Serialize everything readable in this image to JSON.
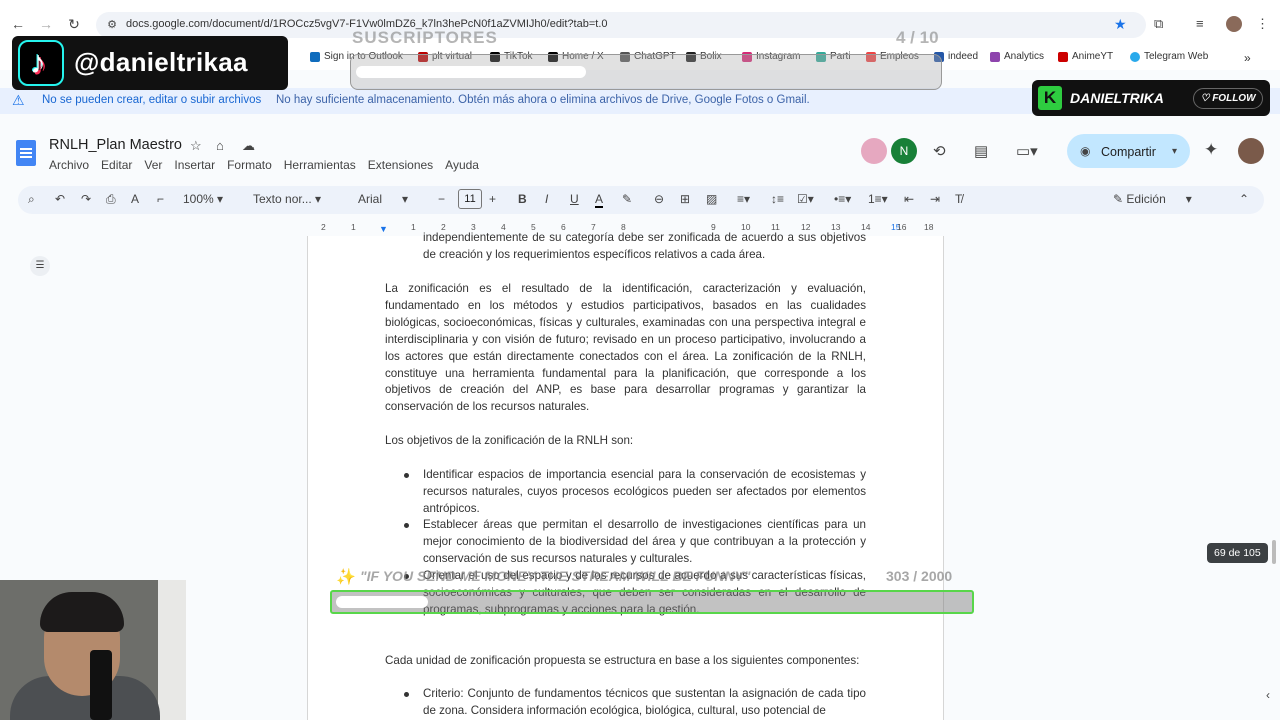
{
  "browser": {
    "url": "docs.google.com/document/d/1ROCcz5vgV7-F1Vw0lmDZ6_k7ln3hePcN0f1aZVMIJh0/edit?tab=t.0"
  },
  "bookmarks": [
    "Sign in to Outlook",
    "plt virtual",
    "TikTok",
    "Home / X",
    "ChatGPT",
    "Bolix",
    "Instagram",
    "Parti",
    "Empleos",
    "indeed",
    "Analytics",
    "AnimeYT",
    "Telegram Web"
  ],
  "warning": {
    "title": "No se pueden crear, editar o subir archivos",
    "message": "No hay suficiente almacenamiento. Obtén más ahora o elimina archivos de Drive, Google Fotos o Gmail."
  },
  "doc": {
    "title": "RNLH_Plan Maestro",
    "menu": [
      "Archivo",
      "Editar",
      "Ver",
      "Insertar",
      "Formato",
      "Herramientas",
      "Extensiones",
      "Ayuda"
    ],
    "avatar_letter": "N",
    "share_label": "Compartir"
  },
  "toolbar": {
    "zoom": "100%",
    "style": "Texto nor...",
    "font": "Arial",
    "font_size": "11",
    "mode": "Edición"
  },
  "ruler": [
    "2",
    "1",
    "1",
    "2",
    "3",
    "4",
    "5",
    "6",
    "7",
    "8",
    "9",
    "10",
    "11",
    "12",
    "13",
    "14",
    "15",
    "16",
    "17",
    "18"
  ],
  "content": {
    "p0": "independientemente de su categoría debe ser zonificada de acuerdo a sus objetivos de creación y los requerimientos específicos relativos a cada área.",
    "p1": "La zonificación es el resultado de la identificación, caracterización y evaluación, fundamentado en los métodos y estudios participativos, basados en las cualidades biológicas, socioeconómicas, físicas y culturales, examinadas con una perspectiva integral e interdisciplinaria y con visión de futuro; revisado en un proceso participativo, involucrando a los actores que están directamente conectados con el área. La zonificación de la RNLH, constituye una herramienta fundamental para la planificación, que corresponde a los objetivos de creación del ANP, es base para desarrollar programas y garantizar la conservación de los recursos naturales.",
    "p2": "Los objetivos de la zonificación de la RNLH son:",
    "b1": "Identificar espacios de importancia esencial para la conservación de ecosistemas y recursos naturales, cuyos procesos ecológicos pueden ser afectados por elementos antrópicos.",
    "b2": "Establecer áreas que permitan el desarrollo de investigaciones científicas para un mejor conocimiento de la biodiversidad del área y que contribuyan a la protección y conservación de sus recursos naturales y culturales.",
    "b3": "Orientar el uso del espacio y de los recursos de acuerdo a sus características físicas, socioeconómicas y culturales, que deben ser consideradas en el desarrollo de programas, subprogramas y acciones para la gestión.",
    "p3": "Cada unidad de zonificación propuesta se estructura en base a los siguientes componentes:",
    "b4": "Criterio: Conjunto de fundamentos técnicos que sustentan la asignación de cada tipo de zona. Considera información ecológica, biológica, cultural, uso potencial de"
  },
  "page_counter": "69 de 105",
  "overlay": {
    "tiktok_handle": "@danieltrikaa",
    "subs_title": "SUSCRIPTORES",
    "subs_count": "4 / 10",
    "brand_name": "DANIELTRIKA",
    "brand_letter": "K",
    "follow_label": "FOLLOW",
    "goal_text": "\"IF YOU SEND ME MONEY THE STREAM WILL BE FUNNY\"",
    "goal_count": "303 / 2000"
  }
}
